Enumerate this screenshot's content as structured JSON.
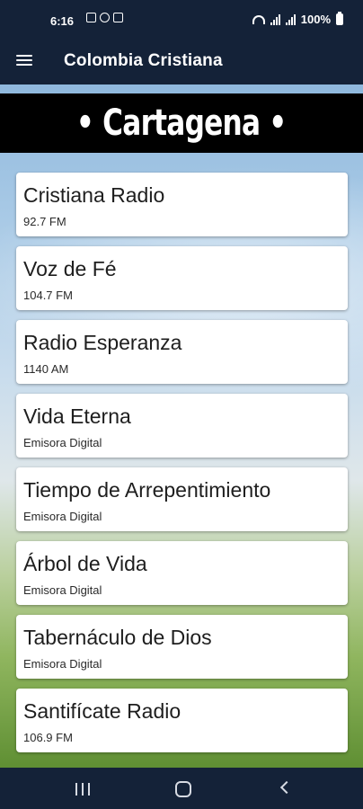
{
  "status_bar": {
    "time": "6:16",
    "battery": "100%"
  },
  "app_bar": {
    "title": "Colombia Cristiana",
    "menu_icon": "hamburger-menu-icon"
  },
  "banner": {
    "text": "• Cartagena •"
  },
  "stations": [
    {
      "name": "Cristiana Radio",
      "sub": "92.7 FM"
    },
    {
      "name": "Voz de Fé",
      "sub": "104.7 FM"
    },
    {
      "name": "Radio Esperanza",
      "sub": "1140 AM"
    },
    {
      "name": "Vida Eterna",
      "sub": "Emisora Digital"
    },
    {
      "name": "Tiempo de Arrepentimiento",
      "sub": "Emisora Digital"
    },
    {
      "name": "Árbol de Vida",
      "sub": "Emisora Digital"
    },
    {
      "name": "Tabernáculo de Dios",
      "sub": "Emisora Digital"
    },
    {
      "name": "Santifícate Radio",
      "sub": "106.9 FM"
    }
  ],
  "nav_bar": {
    "recents_icon": "recents-icon",
    "home_icon": "home-icon",
    "back_icon": "back-icon"
  },
  "colors": {
    "app_bar": "#142238",
    "banner": "#000000",
    "card": "#ffffff"
  }
}
